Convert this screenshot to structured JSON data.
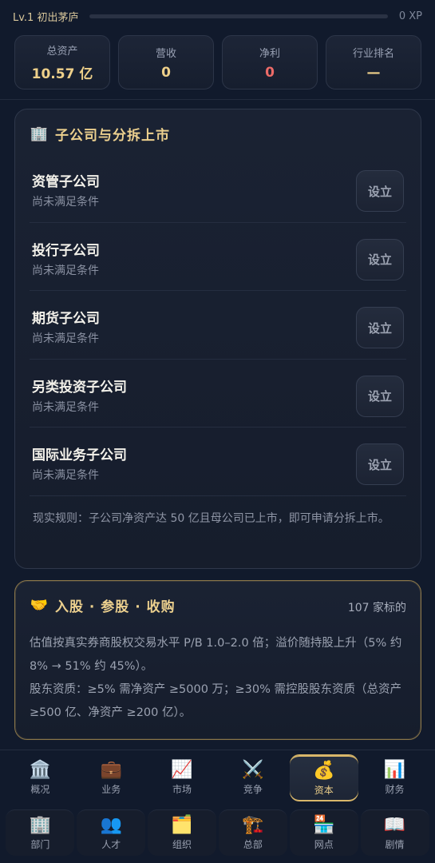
{
  "header": {
    "level": "Lv.1 初出茅庐",
    "xp": "0 XP",
    "xp_progress": 0
  },
  "stats": [
    {
      "label": "总资产",
      "value": "10.57 亿",
      "color": "#eed08a"
    },
    {
      "label": "营收",
      "value": "0",
      "color": "#eed08a"
    },
    {
      "label": "净利",
      "value": "0",
      "color": "#ec6b68"
    },
    {
      "label": "行业排名",
      "value": "—",
      "color": "#eed08a"
    }
  ],
  "subsidiaries": {
    "icon": "building-icon",
    "title": "子公司与分拆上市",
    "rows": [
      {
        "name": "资管子公司",
        "status": "尚未满足条件",
        "button": "设立"
      },
      {
        "name": "投行子公司",
        "status": "尚未满足条件",
        "button": "设立"
      },
      {
        "name": "期货子公司",
        "status": "尚未满足条件",
        "button": "设立"
      },
      {
        "name": "另类投资子公司",
        "status": "尚未满足条件",
        "button": "设立"
      },
      {
        "name": "国际业务子公司",
        "status": "尚未满足条件",
        "button": "设立"
      }
    ],
    "rule": "现实规则：子公司净资产达 50 亿且母公司已上市，即可申请分拆上市。"
  },
  "equity": {
    "icon": "handshake-icon",
    "title": "入股 · 参股 · 收购",
    "count": "107 家标的",
    "text1": "估值按真实券商股权交易水平 P/B 1.0–2.0 倍；溢价随持股上升（5% 约 8% → 51% 约 45%）。",
    "text2": "股东资质：≥5% 需净资产 ≥5000 万；≥30% 需控股股东资质（总资产 ≥500 亿、净资产 ≥200 亿）。"
  },
  "nav_row1": [
    {
      "icon": "🏛️",
      "icon_name": "bank-icon",
      "label": "概况",
      "active": false
    },
    {
      "icon": "💼",
      "icon_name": "briefcase-icon",
      "label": "业务",
      "active": false
    },
    {
      "icon": "📈",
      "icon_name": "chart-up-icon",
      "label": "市场",
      "active": false
    },
    {
      "icon": "⚔️",
      "icon_name": "swords-icon",
      "label": "竞争",
      "active": false
    },
    {
      "icon": "💰",
      "icon_name": "money-bag-icon",
      "label": "资本",
      "active": true
    },
    {
      "icon": "📊",
      "icon_name": "bar-chart-icon",
      "label": "财务",
      "active": false
    }
  ],
  "nav_row2": [
    {
      "icon": "🏢",
      "icon_name": "office-icon",
      "label": "部门"
    },
    {
      "icon": "👥",
      "icon_name": "people-icon",
      "label": "人才"
    },
    {
      "icon": "🗂️",
      "icon_name": "folder-icon",
      "label": "组织"
    },
    {
      "icon": "🏗️",
      "icon_name": "construction-icon",
      "label": "总部"
    },
    {
      "icon": "🏪",
      "icon_name": "store-icon",
      "label": "网点"
    },
    {
      "icon": "📖",
      "icon_name": "book-icon",
      "label": "剧情"
    }
  ]
}
